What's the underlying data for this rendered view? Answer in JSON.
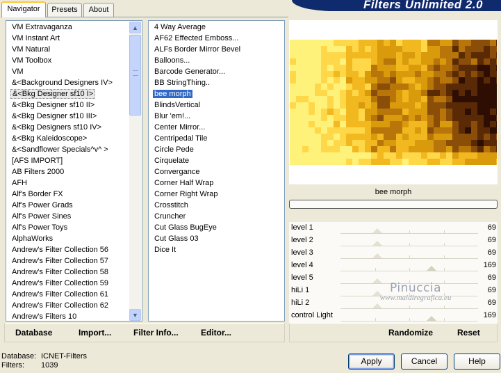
{
  "banner": {
    "title": "Filters Unlimited 2.0"
  },
  "tabs": [
    {
      "label": "Navigator",
      "active": true
    },
    {
      "label": "Presets",
      "active": false
    },
    {
      "label": "About",
      "active": false
    }
  ],
  "categories": {
    "selected_index": 6,
    "items": [
      "VM Extravaganza",
      "VM Instant Art",
      "VM Natural",
      "VM Toolbox",
      "VM",
      "&<Background Designers IV>",
      "&<Bkg Designer sf10 I>",
      "&<Bkg Designer sf10 II>",
      "&<Bkg Designer sf10 III>",
      "&<Bkg Designers sf10 IV>",
      "&<Bkg Kaleidoscope>",
      "&<Sandflower Specials^v^ >",
      "[AFS IMPORT]",
      "AB Filters 2000",
      "AFH",
      "Alf's Border FX",
      "Alf's Power Grads",
      "Alf's Power Sines",
      "Alf's Power Toys",
      "AlphaWorks",
      "Andrew's Filter Collection 56",
      "Andrew's Filter Collection 57",
      "Andrew's Filter Collection 58",
      "Andrew's Filter Collection 59",
      "Andrew's Filter Collection 61",
      "Andrew's Filter Collection 62",
      "Andrew's Filters 10"
    ]
  },
  "filters": {
    "selected_index": 6,
    "items": [
      "4 Way Average",
      "AF62 Effected Emboss...",
      "ALFs Border Mirror Bevel",
      "Balloons...",
      "Barcode Generator...",
      "BB StringThing..",
      "bee morph",
      "BlindsVertical",
      "Blur 'em!...",
      "Center Mirror...",
      "Centripedal Tile",
      "Circle Pede",
      "Cirquelate",
      "Convergance",
      "Corner Half Wrap",
      "Corner Right Wrap",
      "Crosstitch",
      "Cruncher",
      "Cut Glass  BugEye",
      "Cut Glass 03",
      "Dice It"
    ]
  },
  "preview": {
    "filter_name": "bee morph",
    "progress": 0
  },
  "sliders": [
    {
      "label": "level 1",
      "value": "69",
      "fraction": 0.27
    },
    {
      "label": "level 2",
      "value": "69",
      "fraction": 0.27
    },
    {
      "label": "level 3",
      "value": "69",
      "fraction": 0.27
    },
    {
      "label": "level 4",
      "value": "169",
      "fraction": 0.66
    },
    {
      "label": "level 5",
      "value": "69",
      "fraction": 0.27
    },
    {
      "label": "hiLi 1",
      "value": "69",
      "fraction": 0.27
    },
    {
      "label": "hiLi 2",
      "value": "69",
      "fraction": 0.27
    },
    {
      "label": "control Light",
      "value": "169",
      "fraction": 0.66
    }
  ],
  "left_toolbar": {
    "database_label": "Database",
    "import_label": "Import...",
    "filter_info_label": "Filter Info...",
    "editor_label": "Editor..."
  },
  "right_toolbar": {
    "randomize_label": "Randomize",
    "reset_label": "Reset"
  },
  "status": {
    "database_label": "Database:",
    "database_value": "ICNET-Filters",
    "filters_label": "Filters:",
    "filters_value": "1039"
  },
  "buttons": {
    "apply": "Apply",
    "cancel": "Cancel",
    "help": "Help"
  },
  "watermark": {
    "line1": "Pinuccia",
    "line2": "www.maidiregrafica.eu"
  },
  "colors": {
    "selection_blue": "#316ac5",
    "banner_navy": "#102a6e",
    "preview_palette": [
      "#fff27a",
      "#ffd84a",
      "#f2b81f",
      "#d99a0c",
      "#b8760a",
      "#8a4e08",
      "#5a2a06",
      "#2e0e02"
    ]
  }
}
